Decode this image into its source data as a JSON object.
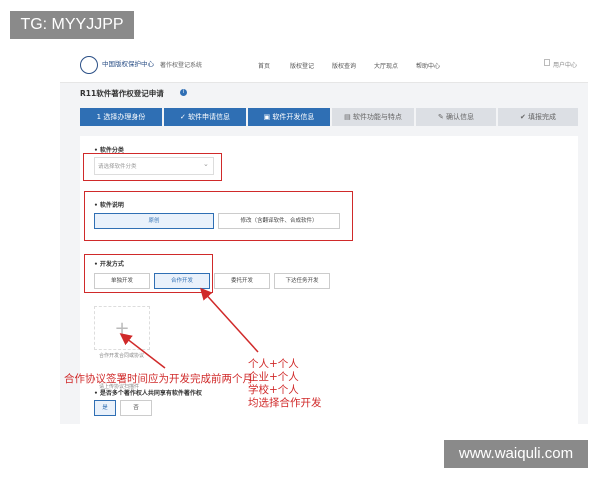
{
  "watermark_top": "TG: MYYJJPP",
  "watermark_bottom": "www.waiquli.com",
  "header": {
    "logo_text": "中国版权保护中心",
    "system_name": "著作权登记系统",
    "nav": [
      "首页",
      "版权登记",
      "版权查询",
      "大厅现点",
      "帮助中心"
    ],
    "user_label": "用户中心"
  },
  "page_title": "R11软件著作权登记申请",
  "info_icon": "i",
  "steps": [
    {
      "label": "选择办理身份",
      "icon": "1"
    },
    {
      "label": "软件申请信息",
      "icon": "✓"
    },
    {
      "label": "软件开发信息",
      "icon": "▣"
    },
    {
      "label": "软件功能与特点",
      "icon": "▤"
    },
    {
      "label": "确认信息",
      "icon": "✎"
    },
    {
      "label": "填报完成",
      "icon": "✔"
    }
  ],
  "software_category": {
    "label": "• 软件分类",
    "placeholder": "请选择软件分类"
  },
  "software_desc": {
    "label": "• 软件说明",
    "options": [
      "原创",
      "修改（含翻译软件、合成软件）"
    ]
  },
  "dev_mode": {
    "label": "• 开发方式",
    "options": [
      "单独开发",
      "合作开发",
      "委托开发",
      "下达任务开发"
    ]
  },
  "upload": {
    "plus": "+",
    "caption": "合作开发合同或协议",
    "note": "请上传协议扫描件"
  },
  "multi_owner": {
    "label": "• 是否多个著作权人共同享有软件著作权",
    "options": [
      "是",
      "否"
    ]
  },
  "annotations": {
    "left": "合作协议签署时间应为开发完成前两个月",
    "right": [
      "个人+个人",
      "企业+个人",
      "学校+个人",
      "均选择合作开发"
    ]
  },
  "colors": {
    "accent": "#2f6fb4",
    "annotation_red": "#d02a2a"
  }
}
